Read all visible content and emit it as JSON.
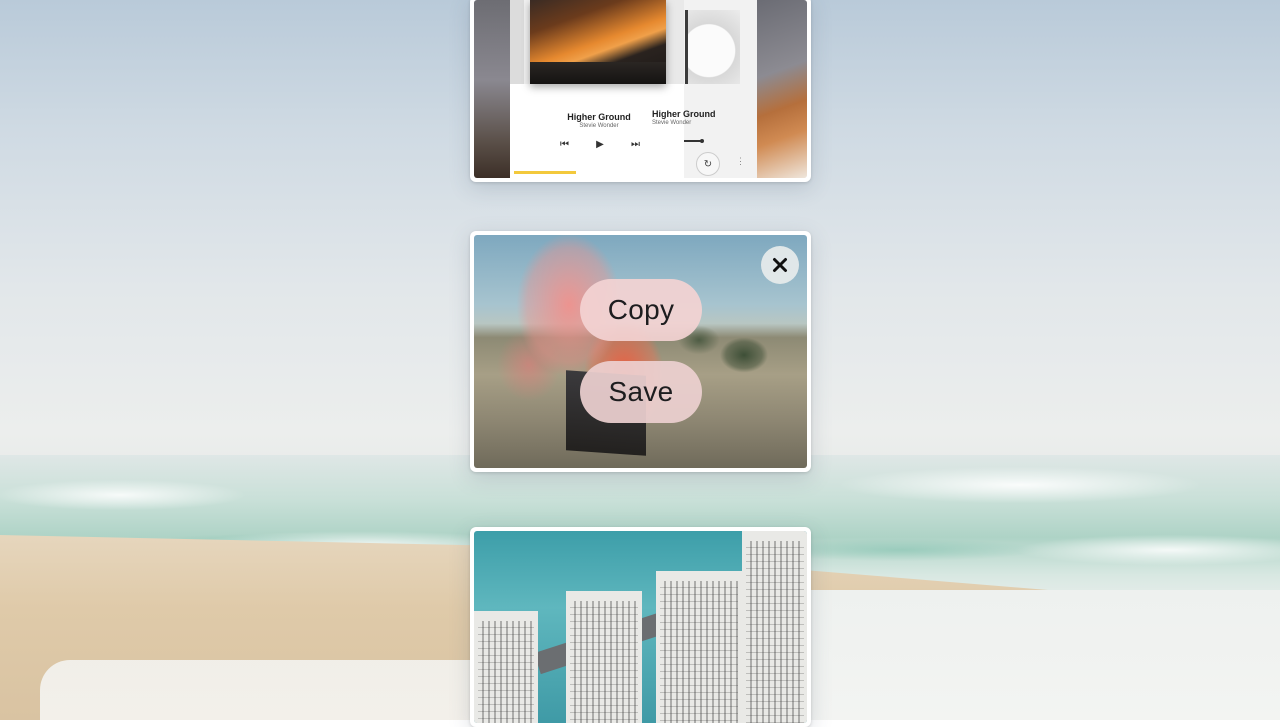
{
  "cards": {
    "top": {
      "tracks": [
        {
          "title": "Higher Ground",
          "artist": "Stevie Wonder"
        },
        {
          "title": "Higher Ground",
          "artist": "Stevie Wonder"
        }
      ],
      "controls": {
        "prev": "⏮",
        "play": "▶",
        "next": "⏭",
        "loop": "↻",
        "more": "⋮"
      }
    },
    "middle": {
      "copy_label": "Copy",
      "save_label": "Save",
      "close_icon": "close-icon"
    },
    "bottom": {}
  },
  "colors": {
    "pill_bg": "#f3d2d2",
    "progress_accent": "#f3c93c"
  }
}
